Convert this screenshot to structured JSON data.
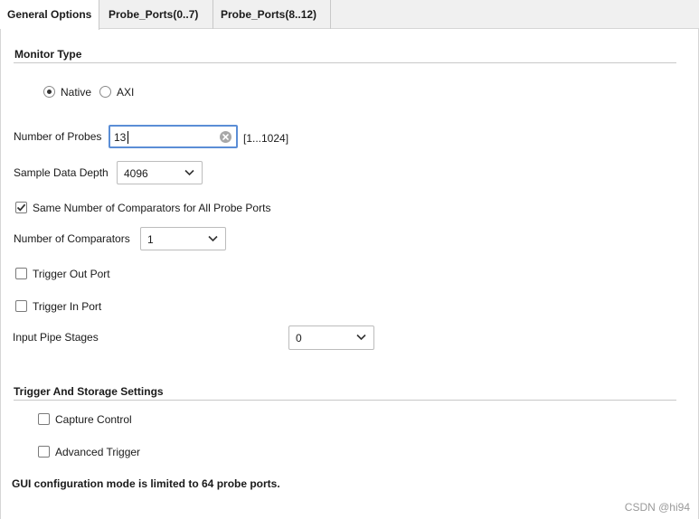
{
  "tabs": [
    {
      "label": "General Options",
      "active": true
    },
    {
      "label": "Probe_Ports(0..7)",
      "active": false
    },
    {
      "label": "Probe_Ports(8..12)",
      "active": false
    }
  ],
  "monitor_type": {
    "title": "Monitor Type",
    "options": [
      {
        "label": "Native",
        "selected": true
      },
      {
        "label": "AXI",
        "selected": false
      }
    ]
  },
  "num_probes": {
    "label": "Number of Probes",
    "value": "13",
    "range": "[1...1024]",
    "clear_icon": "clear-circle-icon"
  },
  "sample_depth": {
    "label": "Sample Data Depth",
    "value": "4096"
  },
  "same_comparators": {
    "label": "Same Number of Comparators for All Probe Ports",
    "checked": true
  },
  "num_comparators": {
    "label": "Number of Comparators",
    "value": "1"
  },
  "trigger_out": {
    "label": "Trigger Out Port",
    "checked": false
  },
  "trigger_in": {
    "label": "Trigger In Port",
    "checked": false
  },
  "pipe_stages": {
    "label": "Input Pipe Stages",
    "value": "0"
  },
  "trigger_storage": {
    "title": "Trigger And Storage Settings",
    "capture_control": {
      "label": "Capture Control",
      "checked": false
    },
    "advanced_trigger": {
      "label": "Advanced Trigger",
      "checked": false
    }
  },
  "note": "GUI configuration mode is limited to 64 probe ports.",
  "watermark": "CSDN @hi94",
  "colors": {
    "focus_border": "#5b8ed6",
    "tab_bar": "#f0f0f0",
    "divider": "#c8c8c8"
  }
}
